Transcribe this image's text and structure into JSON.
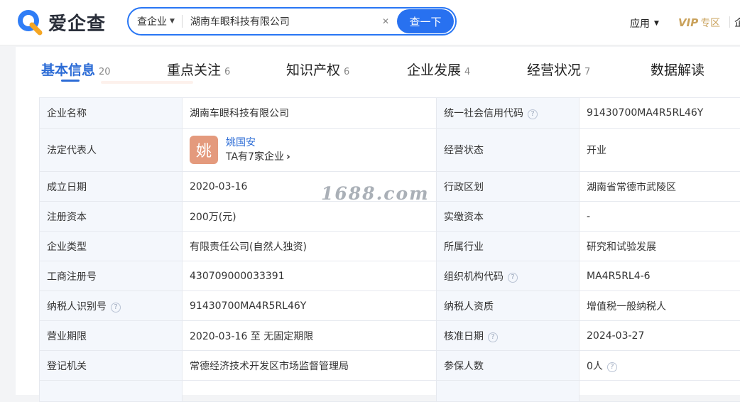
{
  "brand": {
    "name": "爱企查"
  },
  "search": {
    "type_label": "查企业",
    "query": "湖南车眼科技有限公司",
    "button_label": "查一下"
  },
  "nav": {
    "apps_label": "应用",
    "vip_label": "VIP",
    "vip_suffix": "专区",
    "edge_text": "企"
  },
  "tabs": [
    {
      "label": "基本信息",
      "count": "20"
    },
    {
      "label": "重点关注",
      "count": "6"
    },
    {
      "label": "知识产权",
      "count": "6"
    },
    {
      "label": "企业发展",
      "count": "4"
    },
    {
      "label": "经营状况",
      "count": "7"
    },
    {
      "label": "数据解读",
      "count": ""
    }
  ],
  "info": {
    "company_name_label": "企业名称",
    "company_name": "湖南车眼科技有限公司",
    "credit_code_label": "统一社会信用代码",
    "credit_code": "91430700MA4R5RL46Y",
    "legal_rep_label": "法定代表人",
    "legal_rep_avatar": "姚",
    "legal_rep_name": "姚国安",
    "legal_rep_sub": "TA有7家企业",
    "status_label": "经营状态",
    "status": "开业",
    "founded_label": "成立日期",
    "founded": "2020-03-16",
    "region_label": "行政区划",
    "region": "湖南省常德市武陵区",
    "capital_label": "注册资本",
    "capital": "200万(元)",
    "paid_capital_label": "实缴资本",
    "paid_capital": "-",
    "type_label": "企业类型",
    "type": "有限责任公司(自然人独资)",
    "industry_label": "所属行业",
    "industry": "研究和试验发展",
    "reg_no_label": "工商注册号",
    "reg_no": "430709000033391",
    "org_code_label": "组织机构代码",
    "org_code": "MA4R5RL4-6",
    "taxpayer_id_label": "纳税人识别号",
    "taxpayer_id": "91430700MA4R5RL46Y",
    "taxpayer_qual_label": "纳税人资质",
    "taxpayer_qual": "增值税一般纳税人",
    "term_label": "营业期限",
    "term": "2020-03-16 至 无固定期限",
    "approved_label": "核准日期",
    "approved": "2024-03-27",
    "authority_label": "登记机关",
    "authority": "常德经济技术开发区市场监督管理局",
    "insured_label": "参保人数",
    "insured": "0人"
  },
  "watermark": "1688.com",
  "colors": {
    "accent": "#2871f0",
    "vip": "#c9a15a",
    "avatar": "#e49a7d",
    "label_bg": "#f4f7fc"
  }
}
